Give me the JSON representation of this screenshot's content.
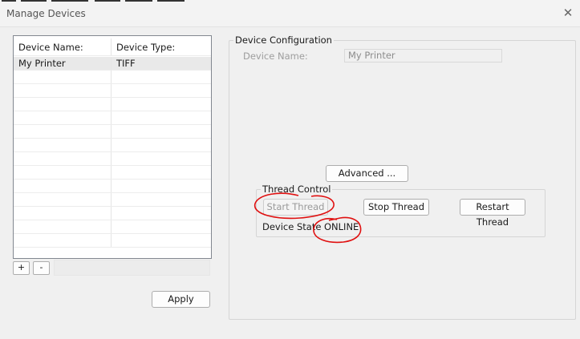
{
  "window": {
    "title": "Manage Devices",
    "close_glyph": "✕"
  },
  "device_list": {
    "columns": [
      "Device Name:",
      "Device Type:"
    ],
    "rows": [
      {
        "name": "My Printer",
        "type": "TIFF"
      }
    ],
    "empty_row_count": 13,
    "add_label": "+",
    "remove_label": "-"
  },
  "apply_label": "Apply",
  "config": {
    "group_title": "Device Configuration",
    "device_name_label": "Device Name:",
    "device_name_value": "My Printer",
    "advanced_label": "Advanced ...",
    "thread_control": {
      "group_title": "Thread Control",
      "start_label": "Start Thread",
      "stop_label": "Stop Thread",
      "restart_label": "Restart Thread",
      "state_label": "Device State",
      "state_value": "ONLINE"
    }
  },
  "colors": {
    "annotation": "#e01010",
    "selection": "#e9e9e9",
    "background": "#f0f0f0"
  },
  "icons": {
    "close": "close-icon"
  }
}
